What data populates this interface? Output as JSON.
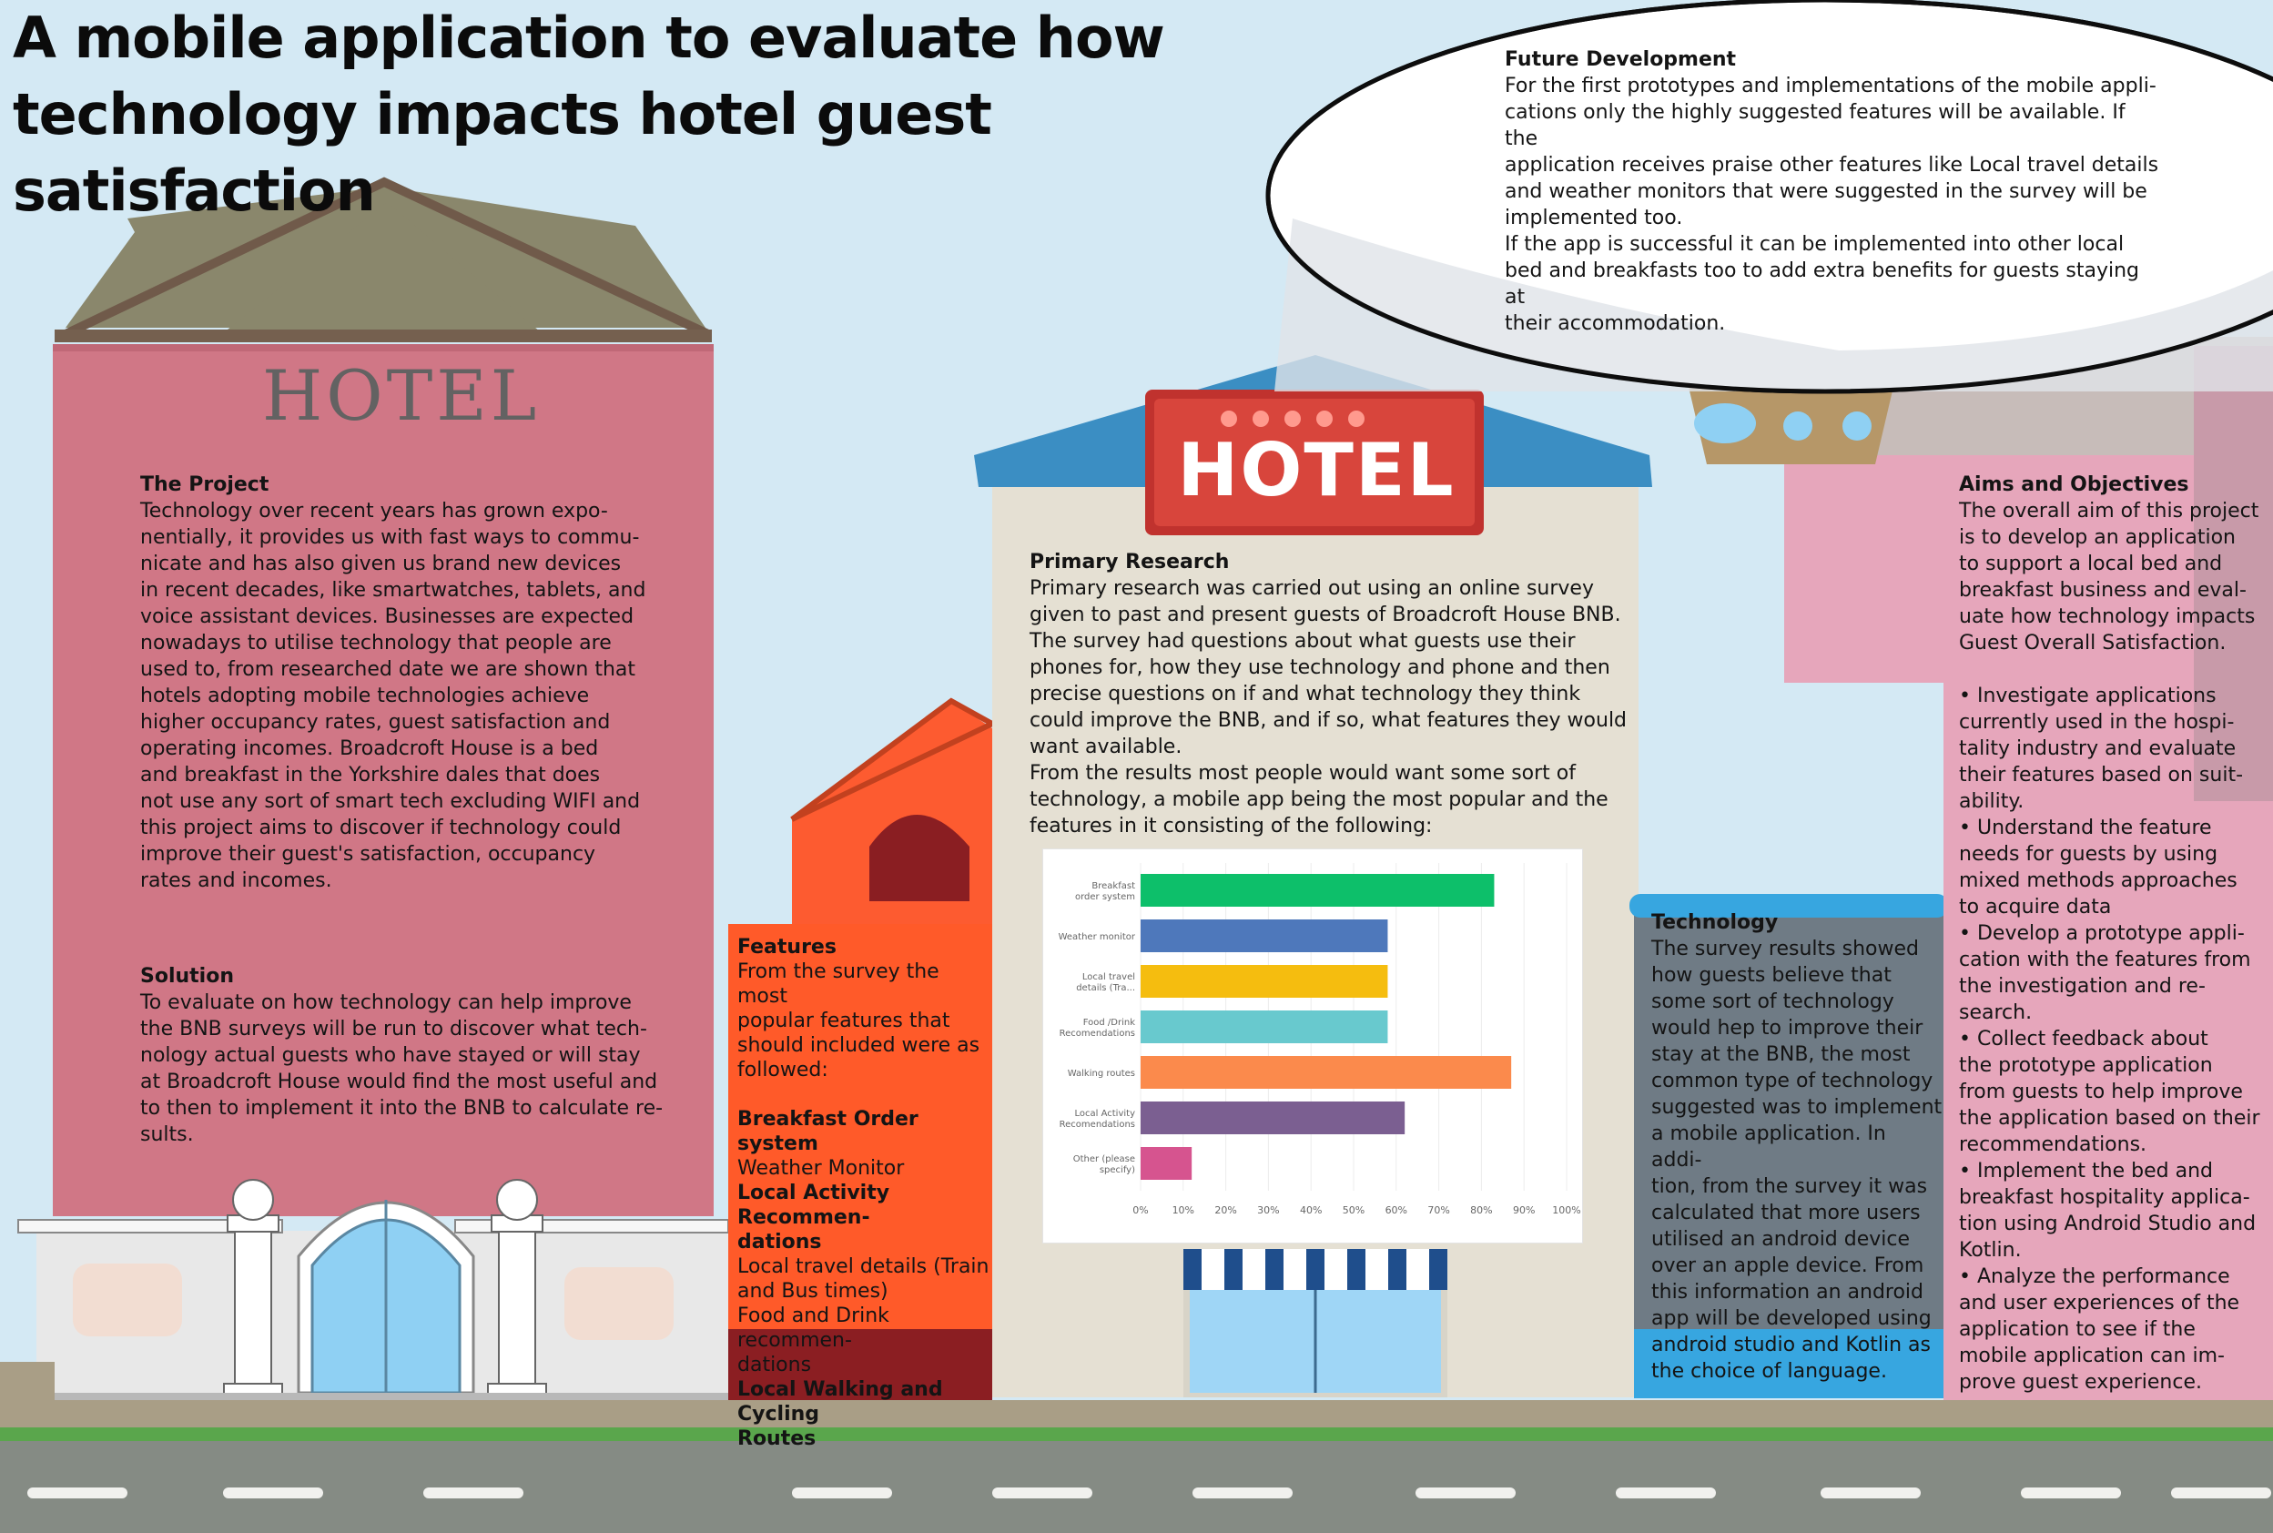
{
  "title": {
    "line1": "A mobile application to evaluate how",
    "line2": "technology impacts hotel guest satisfaction"
  },
  "signs": {
    "left_hotel": "HOTEL",
    "center_hotel": "HOTEL"
  },
  "future": {
    "heading": "Future Development",
    "lines": [
      "For the first prototypes and implementations of the mobile appli-",
      "cations only the highly suggested features will be available. If the",
      "application receives praise other features like Local travel details",
      "and weather monitors that were suggested in the survey will be",
      "implemented too.",
      "If the app is successful it can be implemented into other local",
      "bed and breakfasts too to add extra benefits for guests staying at",
      "their accommodation."
    ]
  },
  "project": {
    "heading": "The Project",
    "lines": [
      "Technology over recent years has grown expo-",
      "nentially, it provides us with fast ways to commu-",
      "nicate and has also given us brand new devices",
      "in recent decades, like smartwatches, tablets, and",
      "voice assistant devices. Businesses are expected",
      "nowadays to utilise technology that people are",
      "used to, from researched date we are shown that",
      "hotels adopting mobile technologies achieve",
      "higher occupancy rates, guest satisfaction and",
      "operating incomes. Broadcroft House is a bed",
      "and breakfast in the Yorkshire dales that does",
      "not use any sort of smart tech excluding WIFI and",
      "this project aims to discover if technology could",
      "improve their guest's satisfaction, occupancy",
      "rates and incomes."
    ]
  },
  "solution": {
    "heading": "Solution",
    "lines": [
      "To evaluate on how technology can help improve",
      "the BNB surveys will be run to discover what tech-",
      "nology actual guests who have stayed or will stay",
      "at Broadcroft House would find the most useful and",
      "to then to implement it into the BNB to calculate re-",
      "sults."
    ]
  },
  "features": {
    "heading": "Features",
    "intro": [
      "From the survey the most",
      "popular features that",
      "should included were as",
      "followed:"
    ],
    "items": [
      {
        "text": "Breakfast Order system",
        "bold": true
      },
      {
        "text": "Weather Monitor",
        "bold": false
      },
      {
        "text": "Local Activity Recommen-",
        "bold": true
      },
      {
        "text": "dations",
        "bold": true
      },
      {
        "text": "Local travel details (Train",
        "bold": false
      },
      {
        "text": "and Bus times)",
        "bold": false
      },
      {
        "text": "Food and Drink recommen-",
        "bold": false
      },
      {
        "text": "dations",
        "bold": false
      },
      {
        "text": "Local Walking and Cycling",
        "bold": true
      },
      {
        "text": "Routes",
        "bold": true
      }
    ]
  },
  "research": {
    "heading": "Primary Research",
    "lines": [
      "Primary research was carried out using an online survey",
      "given to past and present guests of Broadcroft House BNB.",
      "The survey had questions about what guests use their",
      "phones for, how they use technology and phone and then",
      "precise questions on if and what technology they think",
      "could improve the BNB, and if so, what features they would",
      "want available.",
      "From the results most people would want some sort of",
      "technology, a mobile app being the most popular and the",
      "features in it consisting of the following:"
    ]
  },
  "technology": {
    "heading": "Technology",
    "lines": [
      "The survey results showed",
      "how guests believe that",
      "some sort of technology",
      "would hep to improve their",
      "stay at the BNB, the most",
      "common type of technology",
      "suggested was to implement",
      "a mobile application. In addi-",
      "tion, from the survey it was",
      "calculated that more users",
      "utilised an android device",
      "over an apple device. From",
      "this information an android",
      "app will be developed using",
      "android studio and Kotlin as",
      "the choice of language."
    ]
  },
  "aims": {
    "heading": "Aims and Objectives",
    "intro": [
      "The overall aim of this project",
      "is to develop an application",
      "to support a local bed and",
      "breakfast business and eval-",
      "uate how technology impacts",
      "Guest Overall Satisfaction."
    ],
    "bullets": [
      "•     Investigate applications",
      "currently used in the hospi-",
      "tality industry and evaluate",
      "their features based on suit-",
      "ability.",
      "•     Understand the feature",
      "needs for guests by using",
      "mixed methods approaches",
      "to acquire data",
      "•     Develop a prototype appli-",
      "cation with the features from",
      "the investigation and re-",
      "search.",
      "•     Collect feedback about",
      "the prototype application",
      "from guests to help improve",
      "the application based on their",
      "recommendations.",
      "•     Implement the bed and",
      "breakfast hospitality applica-",
      "tion using Android Studio and",
      "Kotlin.",
      "•     Analyze the performance",
      "and user experiences of the",
      "application to see if the",
      "mobile application can im-",
      "prove guest experience."
    ]
  },
  "chart_data": {
    "type": "bar",
    "orientation": "horizontal",
    "categories": [
      [
        "Breakfast",
        "order system"
      ],
      [
        "Weather monitor"
      ],
      [
        "Local travel",
        "details (Tra..."
      ],
      [
        "Food /Drink",
        "Recomendations"
      ],
      [
        "Walking routes"
      ],
      [
        "Local Activity",
        "Recomendations"
      ],
      [
        "Other (please",
        "specify)"
      ]
    ],
    "values": [
      83,
      58,
      58,
      58,
      87,
      62,
      12
    ],
    "colors": [
      "#0dbf6a",
      "#4e78bb",
      "#f5bd0f",
      "#68c9ce",
      "#fb8a4c",
      "#7b5f91",
      "#d6548f"
    ],
    "xticks": [
      "0%",
      "10%",
      "20%",
      "30%",
      "40%",
      "50%",
      "60%",
      "70%",
      "80%",
      "90%",
      "100%"
    ],
    "xlim": [
      0,
      100
    ],
    "grid": true
  }
}
